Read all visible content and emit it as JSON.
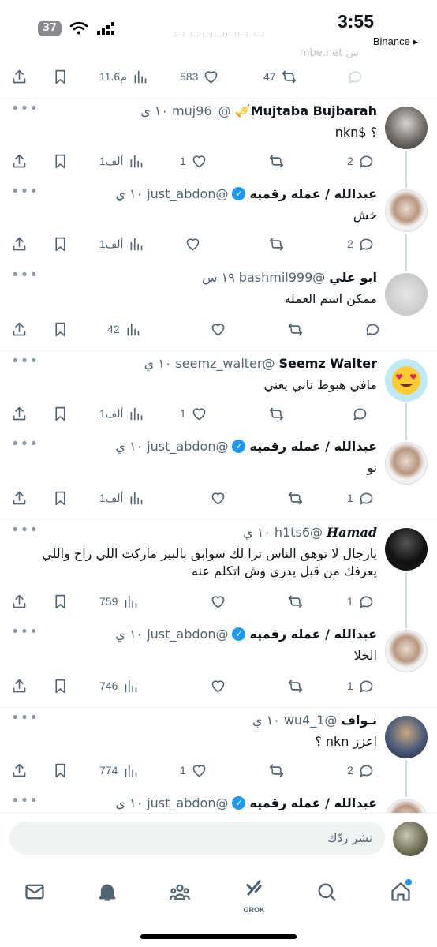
{
  "status_bar": {
    "battery": "37",
    "time": "3:55",
    "back_app": "Binance ▸"
  },
  "partial_top": {
    "link_fragment": "mbe.net س",
    "views": "11.6م",
    "likes": "583",
    "retweets": "47"
  },
  "tweets": [
    {
      "name": "Mujtaba Bujbarah🎺",
      "handle": "@_muj96",
      "time": "١٠ ي",
      "text": "؟ $nkn",
      "replies": "2",
      "retweets": "",
      "likes": "1",
      "views": "1ألف"
    },
    {
      "name": "عبدالله / عمله رقميه",
      "handle": "@just_abdon",
      "time": "١٠ ي",
      "text": "خش",
      "replies": "2",
      "retweets": "",
      "likes": "",
      "views": "1ألف"
    },
    {
      "name": "ابو علي",
      "handle": "@bashmil999",
      "time": "١٩ س",
      "text": "ممكن اسم العمله",
      "replies": "",
      "retweets": "",
      "likes": "",
      "views": "42"
    },
    {
      "name": "Seemz Walter",
      "handle": "@seemz_walter",
      "time": "١٠ ي",
      "text": "مافي هبوط تاني يعني",
      "replies": "",
      "retweets": "",
      "likes": "1",
      "views": "1ألف"
    },
    {
      "name": "عبدالله / عمله رقميه",
      "handle": "@just_abdon",
      "time": "١٠ ي",
      "text": "نو",
      "replies": "1",
      "retweets": "",
      "likes": "",
      "views": "1ألف"
    },
    {
      "name": "Hamad",
      "handle": "@h1ts6",
      "time": "١٠ ي",
      "text": "يارجال لا توهق الناس ترا لك سوابق بالبير ماركت اللي راح واللي يعرفك من قبل يدري وش اتكلم عنه",
      "replies": "1",
      "retweets": "",
      "likes": "",
      "views": "759"
    },
    {
      "name": "عبدالله / عمله رقميه",
      "handle": "@just_abdon",
      "time": "١٠ ي",
      "text": "الخلا",
      "replies": "1",
      "retweets": "",
      "likes": "",
      "views": "746"
    },
    {
      "name": "نـواف",
      "handle": "@1_wu4",
      "time": "١٠ ي",
      "text": "اعزز nkn ؟",
      "replies": "2",
      "retweets": "",
      "likes": "1",
      "views": "774"
    }
  ],
  "partial_bottom": {
    "name": "عبدالله / عمله رقميه",
    "handle": "@just_abdon",
    "time": "١٠ ي"
  },
  "reply_bar": {
    "placeholder": "نشر ردّك"
  },
  "tabs": {
    "grok_label": "GROK"
  },
  "colors": {
    "accent": "#1d9bf0",
    "muted": "#536471",
    "line": "#cfd9de"
  }
}
